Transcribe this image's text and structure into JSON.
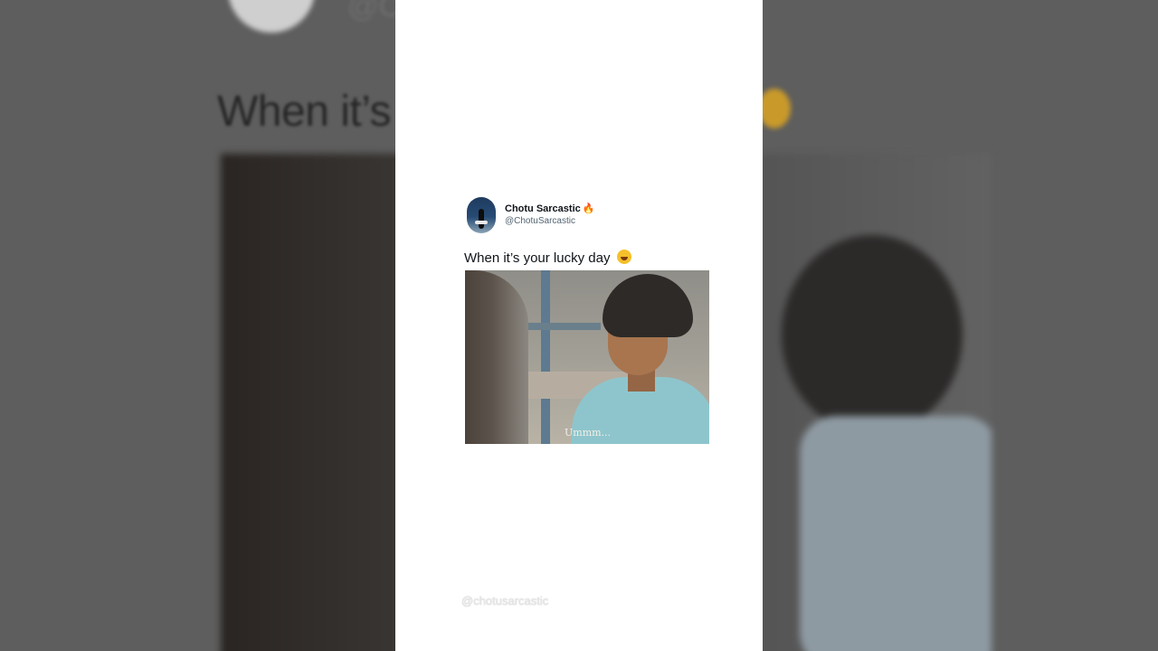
{
  "post": {
    "display_name": "Chotu Sarcastic",
    "verified_emoji": "🔥",
    "handle": "@ChotuSarcastic",
    "caption": "When it’s your lucky day",
    "caption_emoji": "laughing-with-tears-emoji",
    "media": {
      "subtitle": "Ummm..."
    }
  },
  "watermark": "@chotusarcastic",
  "background": {
    "handle_partial": "@C",
    "caption_partial": "When it’s"
  },
  "colors": {
    "card_bg": "#ffffff",
    "name": "#0f1419",
    "handle": "#536471",
    "page_bg": "#5e5e5e"
  }
}
